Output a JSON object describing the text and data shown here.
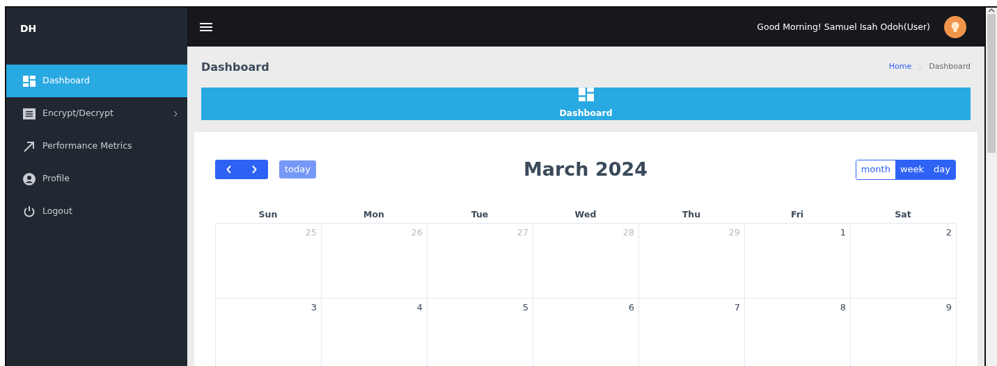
{
  "sidebar": {
    "brand": "DH",
    "items": [
      {
        "label": "Dashboard",
        "kind": "dashboard",
        "selected": true,
        "has_submenu": false
      },
      {
        "label": "Encrypt/Decrypt",
        "kind": "list",
        "selected": false,
        "has_submenu": true
      },
      {
        "label": "Performance Metrics",
        "kind": "metrics",
        "selected": false,
        "has_submenu": false
      },
      {
        "label": "Profile",
        "kind": "profile",
        "selected": false,
        "has_submenu": false
      },
      {
        "label": "Logout",
        "kind": "logout",
        "selected": false,
        "has_submenu": false
      }
    ]
  },
  "topbar": {
    "greeting": "Good Morning! Samuel Isah Odoh(User)"
  },
  "page_header": {
    "title": "Dashboard",
    "breadcrumb": [
      "Home",
      "Dashboard"
    ]
  },
  "banner": {
    "label": "Dashboard"
  },
  "calendar": {
    "title": "March 2024",
    "today_button": "today",
    "views": [
      {
        "label": "month",
        "selected": true
      },
      {
        "label": "week",
        "selected": false
      },
      {
        "label": "day",
        "selected": false
      }
    ],
    "weekdays": [
      "Sun",
      "Mon",
      "Tue",
      "Wed",
      "Thu",
      "Fri",
      "Sat"
    ],
    "weeks": [
      [
        {
          "day": "25",
          "other_month": true
        },
        {
          "day": "26",
          "other_month": true
        },
        {
          "day": "27",
          "other_month": true
        },
        {
          "day": "28",
          "other_month": true
        },
        {
          "day": "29",
          "other_month": true
        },
        {
          "day": "1",
          "other_month": false
        },
        {
          "day": "2",
          "other_month": false
        }
      ],
      [
        {
          "day": "3",
          "other_month": false
        },
        {
          "day": "4",
          "other_month": false
        },
        {
          "day": "5",
          "other_month": false
        },
        {
          "day": "6",
          "other_month": false
        },
        {
          "day": "7",
          "other_month": false
        },
        {
          "day": "8",
          "other_month": false
        },
        {
          "day": "9",
          "other_month": false
        }
      ]
    ]
  }
}
